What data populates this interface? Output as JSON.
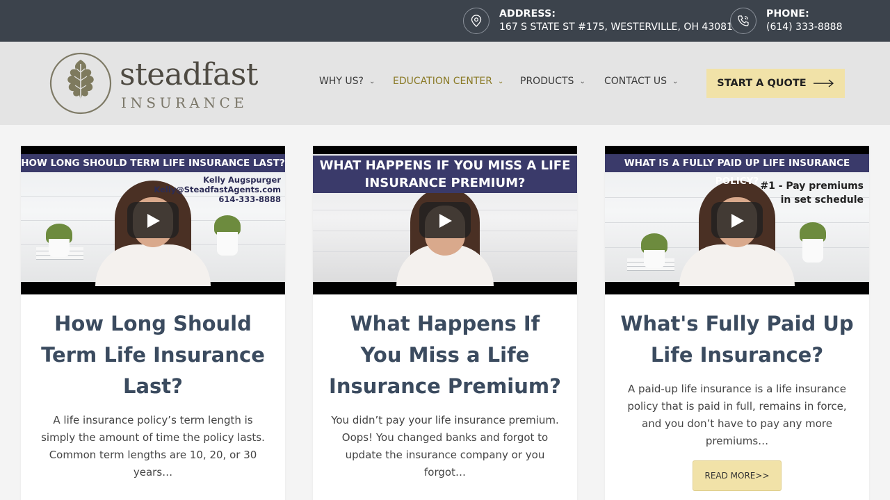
{
  "topbar": {
    "address_label": "ADDRESS:",
    "address_value": "167 S STATE ST #175, WESTERVILLE, OH 43081",
    "phone_label": "PHONE:",
    "phone_value": "(614) 333-8888"
  },
  "logo": {
    "word1": "steadfast",
    "word2": "INSURANCE"
  },
  "nav": {
    "items": [
      {
        "label": "WHY US?"
      },
      {
        "label": "EDUCATION CENTER",
        "active": true
      },
      {
        "label": "PRODUCTS"
      },
      {
        "label": "CONTACT US"
      }
    ],
    "cta": "START A QUOTE"
  },
  "colors": {
    "topbar": "#3c434c",
    "accent": "#f1e2a8",
    "active_nav": "#8a7a26",
    "title": "#3b4b5f"
  },
  "cards": [
    {
      "video_banner": "HOW LONG SHOULD TERM LIFE INSURANCE LAST?",
      "video_overlay": [
        "Kelly Augspurger",
        "Kelly@SteadfastAgents.com",
        "614-333-8888"
      ],
      "title": "How Long Should Term Life Insurance Last?",
      "excerpt": "A life insurance policy’s term length is simply the amount of time the policy lasts. Common term lengths are 10, 20, or 30 years…"
    },
    {
      "video_banner": "WHAT HAPPENS IF YOU MISS A LIFE INSURANCE PREMIUM?",
      "title": "What Happens If You Miss a Life Insurance Premium?",
      "excerpt": "You didn’t pay your life insurance premium. Oops! You changed banks and forgot to update the insurance company or you forgot…"
    },
    {
      "video_banner": "WHAT IS A FULLY PAID UP LIFE INSURANCE POLICY?",
      "video_overlay": [
        "#1 - Pay premiums",
        "in set schedule"
      ],
      "title": "What's Fully Paid Up Life Insurance?",
      "excerpt": "A paid-up life insurance is a life insurance policy that is paid in full, remains in force, and you don’t have to pay any more premiums…",
      "read_more": "READ MORE>>"
    }
  ]
}
